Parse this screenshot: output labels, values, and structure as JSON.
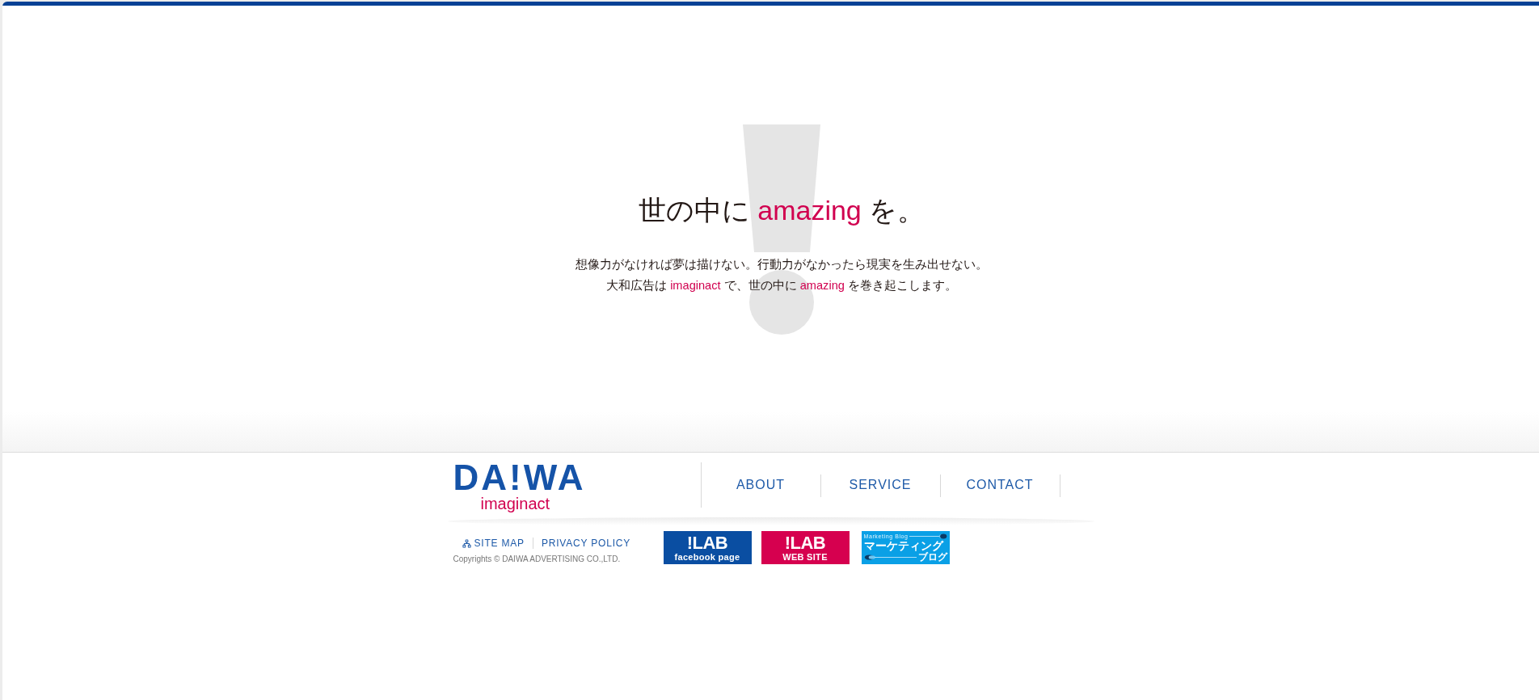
{
  "hero": {
    "headline": [
      {
        "text": "世の中に ",
        "accent": false
      },
      {
        "text": "amazing",
        "accent": true
      },
      {
        "text": " を。",
        "accent": false
      }
    ],
    "paragraph": [
      [
        {
          "text": "想像力がなければ夢は描けない。行動力がなかったら現実を生み出せない。",
          "accent": false
        }
      ],
      [
        {
          "text": "大和広告は ",
          "accent": false
        },
        {
          "text": "imaginact",
          "accent": true
        },
        {
          "text": " で、世の中に ",
          "accent": false
        },
        {
          "text": "amazing",
          "accent": true
        },
        {
          "text": " を巻き起こします。",
          "accent": false
        }
      ]
    ]
  },
  "footer": {
    "logo": {
      "wordmark": "DA!WA",
      "tagline": "imaginact"
    },
    "nav": [
      {
        "label": "ABOUT"
      },
      {
        "label": "SERVICE"
      },
      {
        "label": "CONTACT"
      }
    ],
    "links": [
      {
        "label": "SITE MAP",
        "kind": "sitemap"
      },
      {
        "label": "PRIVACY POLICY",
        "kind": "plain"
      }
    ],
    "copyright": "Copyrights © DAIWA ADVERTISING CO.,LTD.",
    "banners": [
      {
        "kind": "lab",
        "title": "!LAB",
        "subtitle": "facebook page",
        "color": "#0a4ea2"
      },
      {
        "kind": "lab",
        "title": "!LAB",
        "subtitle": "WEB SITE",
        "color": "#d6004f"
      },
      {
        "kind": "blog",
        "overline": "Marketing Blog",
        "title": "マーケティング",
        "subtitle": "ブログ",
        "color": "#0aa0e6"
      }
    ]
  }
}
